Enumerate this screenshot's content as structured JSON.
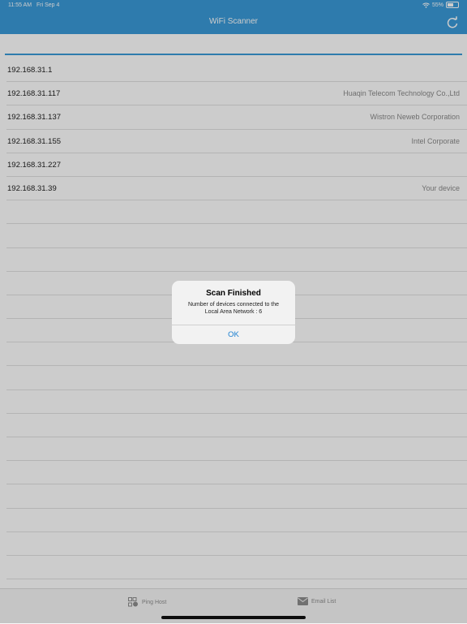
{
  "status_bar": {
    "time": "11:55 AM",
    "date": "Fri Sep 4",
    "battery": "55%",
    "battery_level": 0.55,
    "wifi_icon": "wifi-icon",
    "battery_icon": "battery-icon"
  },
  "nav": {
    "title": "WiFi Scanner",
    "refresh_icon": "refresh-icon"
  },
  "devices": [
    {
      "ip": "192.168.31.1",
      "vendor": ""
    },
    {
      "ip": "192.168.31.117",
      "vendor": "Huaqin Telecom Technology Co.,Ltd"
    },
    {
      "ip": "192.168.31.137",
      "vendor": "Wistron Neweb Corporation"
    },
    {
      "ip": "192.168.31.155",
      "vendor": "Intel Corporate"
    },
    {
      "ip": "192.168.31.227",
      "vendor": ""
    },
    {
      "ip": "192.168.31.39",
      "vendor": "Your device"
    }
  ],
  "alert": {
    "title": "Scan Finished",
    "message_line1": "Number of devices connected to the",
    "message_line2": "Local Area Network : 6",
    "ok_label": "OK"
  },
  "tabs": [
    {
      "label": "Ping Host",
      "icon": "ping-host-icon"
    },
    {
      "label": "Email List",
      "icon": "mail-icon"
    }
  ],
  "colors": {
    "accent": "#3a9ad9",
    "alert_button": "#1a7fd0"
  }
}
